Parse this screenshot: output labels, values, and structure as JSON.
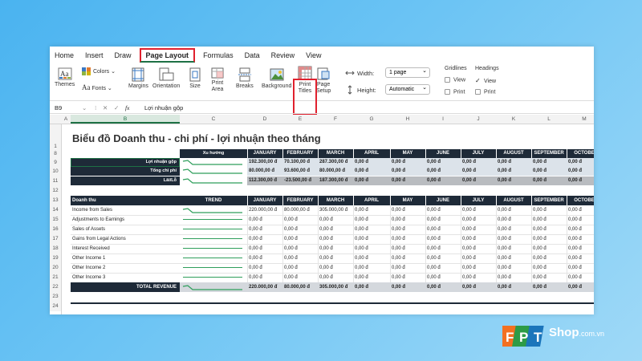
{
  "ribbon": {
    "tabs": [
      "Home",
      "Insert",
      "Draw",
      "Page Layout",
      "Formulas",
      "Data",
      "Review",
      "View"
    ],
    "active_tab": "Page Layout",
    "themes": "Themes",
    "colors": "Colors",
    "fonts": "Fonts",
    "margins": "Margins",
    "orientation": "Orientation",
    "size": "Size",
    "print_area": "Print\nArea",
    "breaks": "Breaks",
    "background": "Background",
    "print_titles": "Print\nTitles",
    "page_setup": "Page\nSetup",
    "width_label": "Width:",
    "width_value": "1 page",
    "height_label": "Height:",
    "height_value": "Automatic",
    "gridlines": "Gridlines",
    "headings": "Headings",
    "view": "View",
    "print": "Print",
    "headings_view_checked": true
  },
  "formula_bar": {
    "name_box": "B9",
    "fx": "fx",
    "content": "Lợi nhuận gộp"
  },
  "columns": [
    "A",
    "B",
    "C",
    "D",
    "E",
    "F",
    "G",
    "H",
    "I",
    "J",
    "K",
    "L",
    "M"
  ],
  "row_numbers": [
    "1",
    "8",
    "9",
    "10",
    "11",
    "12",
    "13",
    "14",
    "15",
    "16",
    "17",
    "18",
    "19",
    "20",
    "21",
    "22",
    "23",
    "24"
  ],
  "sheet_title": "Biểu đồ Doanh thu - chi phí - lợi nhuận theo tháng",
  "months": [
    "JANUARY",
    "FEBRUARY",
    "MARCH",
    "APRIL",
    "MAY",
    "JUNE",
    "JULY",
    "AUGUST",
    "SEPTEMBER",
    "OCTOBE"
  ],
  "summary": {
    "trend_header": "Xu hướng",
    "rows": [
      {
        "label": "Lợi nhuận gộp",
        "values": [
          "192.300,00 đ",
          "70.100,00 đ",
          "287.300,00 đ",
          "0,00 đ",
          "0,00 đ",
          "0,00 đ",
          "0,00 đ",
          "0,00 đ",
          "0,00 đ",
          "0,00 đ"
        ]
      },
      {
        "label": "Tổng chi phí",
        "values": [
          "80.000,00 đ",
          "93.600,00 đ",
          "80.000,00 đ",
          "0,00 đ",
          "0,00 đ",
          "0,00 đ",
          "0,00 đ",
          "0,00 đ",
          "0,00 đ",
          "0,00 đ"
        ]
      },
      {
        "label": "Lãi/Lỗ",
        "values": [
          "112.300,00 đ",
          "-23.500,00 đ",
          "187.300,00 đ",
          "0,00 đ",
          "0,00 đ",
          "0,00 đ",
          "0,00 đ",
          "0,00 đ",
          "0,00 đ",
          "0,00 đ"
        ]
      }
    ]
  },
  "revenue": {
    "header_label": "Doanh thu",
    "trend_header": "TREND",
    "rows": [
      {
        "label": "Income from Sales",
        "values": [
          "220.000,00 đ",
          "80.000,00 đ",
          "305.000,00 đ",
          "0,00 đ",
          "0,00 đ",
          "0,00 đ",
          "0,00 đ",
          "0,00 đ",
          "0,00 đ",
          "0,00 đ"
        ]
      },
      {
        "label": "Adjustments to Earnings",
        "values": [
          "0,00 đ",
          "0,00 đ",
          "0,00 đ",
          "0,00 đ",
          "0,00 đ",
          "0,00 đ",
          "0,00 đ",
          "0,00 đ",
          "0,00 đ",
          "0,00 đ"
        ]
      },
      {
        "label": "Sales of Assets",
        "values": [
          "0,00 đ",
          "0,00 đ",
          "0,00 đ",
          "0,00 đ",
          "0,00 đ",
          "0,00 đ",
          "0,00 đ",
          "0,00 đ",
          "0,00 đ",
          "0,00 đ"
        ]
      },
      {
        "label": "Gains from Legal Actions",
        "values": [
          "0,00 đ",
          "0,00 đ",
          "0,00 đ",
          "0,00 đ",
          "0,00 đ",
          "0,00 đ",
          "0,00 đ",
          "0,00 đ",
          "0,00 đ",
          "0,00 đ"
        ]
      },
      {
        "label": "Interest Received",
        "values": [
          "0,00 đ",
          "0,00 đ",
          "0,00 đ",
          "0,00 đ",
          "0,00 đ",
          "0,00 đ",
          "0,00 đ",
          "0,00 đ",
          "0,00 đ",
          "0,00 đ"
        ]
      },
      {
        "label": "Other Income 1",
        "values": [
          "0,00 đ",
          "0,00 đ",
          "0,00 đ",
          "0,00 đ",
          "0,00 đ",
          "0,00 đ",
          "0,00 đ",
          "0,00 đ",
          "0,00 đ",
          "0,00 đ"
        ]
      },
      {
        "label": "Other Income 2",
        "values": [
          "0,00 đ",
          "0,00 đ",
          "0,00 đ",
          "0,00 đ",
          "0,00 đ",
          "0,00 đ",
          "0,00 đ",
          "0,00 đ",
          "0,00 đ",
          "0,00 đ"
        ]
      },
      {
        "label": "Other Income 3",
        "values": [
          "0,00 đ",
          "0,00 đ",
          "0,00 đ",
          "0,00 đ",
          "0,00 đ",
          "0,00 đ",
          "0,00 đ",
          "0,00 đ",
          "0,00 đ",
          "0,00 đ"
        ]
      }
    ],
    "total_label": "TOTAL REVENUE",
    "total_values": [
      "220.000,00 đ",
      "80.000,00 đ",
      "305.000,00 đ",
      "0,00 đ",
      "0,00 đ",
      "0,00 đ",
      "0,00 đ",
      "0,00 đ",
      "0,00 đ",
      "0,00 đ"
    ]
  },
  "brand": {
    "logo": "FPT",
    "shop": "Shop",
    "domain": ".com.vn"
  },
  "colors": {
    "header_dark": "#1e2a38",
    "sparkline": "#2e9e5b",
    "negative": "#c0392b",
    "highlight": "#e0212e"
  }
}
